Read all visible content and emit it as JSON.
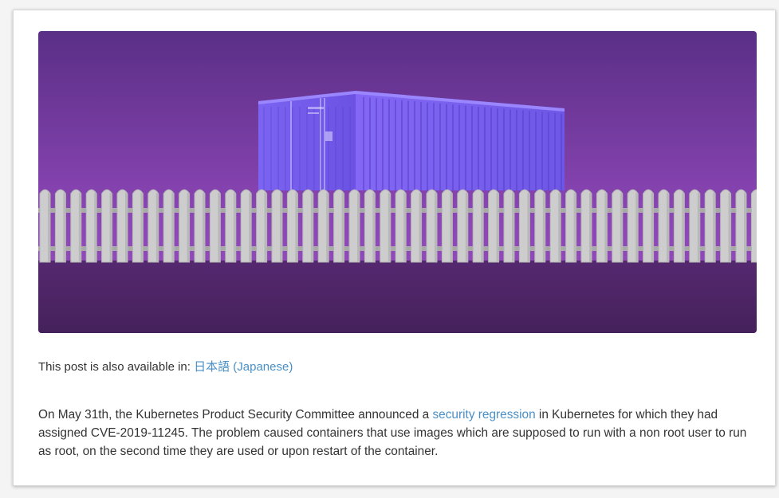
{
  "post": {
    "availability_prefix": "This post is also available in: ",
    "availability_link": "日本語 (Japanese)",
    "para_part1": "On May 31th, the Kubernetes Product Security Committee announced a ",
    "para_link": "security regression",
    "para_part2": " in Kubernetes for which they had assigned CVE-2019-11245. The problem caused containers that use images which are supposed to run with a non root user to run as root, on the second time they are used or upon restart of the container."
  },
  "hero_image": {
    "description_icon": "container-behind-fence-illustration",
    "colors": {
      "sky_top": "#5a2f86",
      "sky_bottom": "#8a45b4",
      "ground": "#4a2260",
      "container": "#7a5cf0",
      "fence": "#c9c9c9"
    }
  }
}
